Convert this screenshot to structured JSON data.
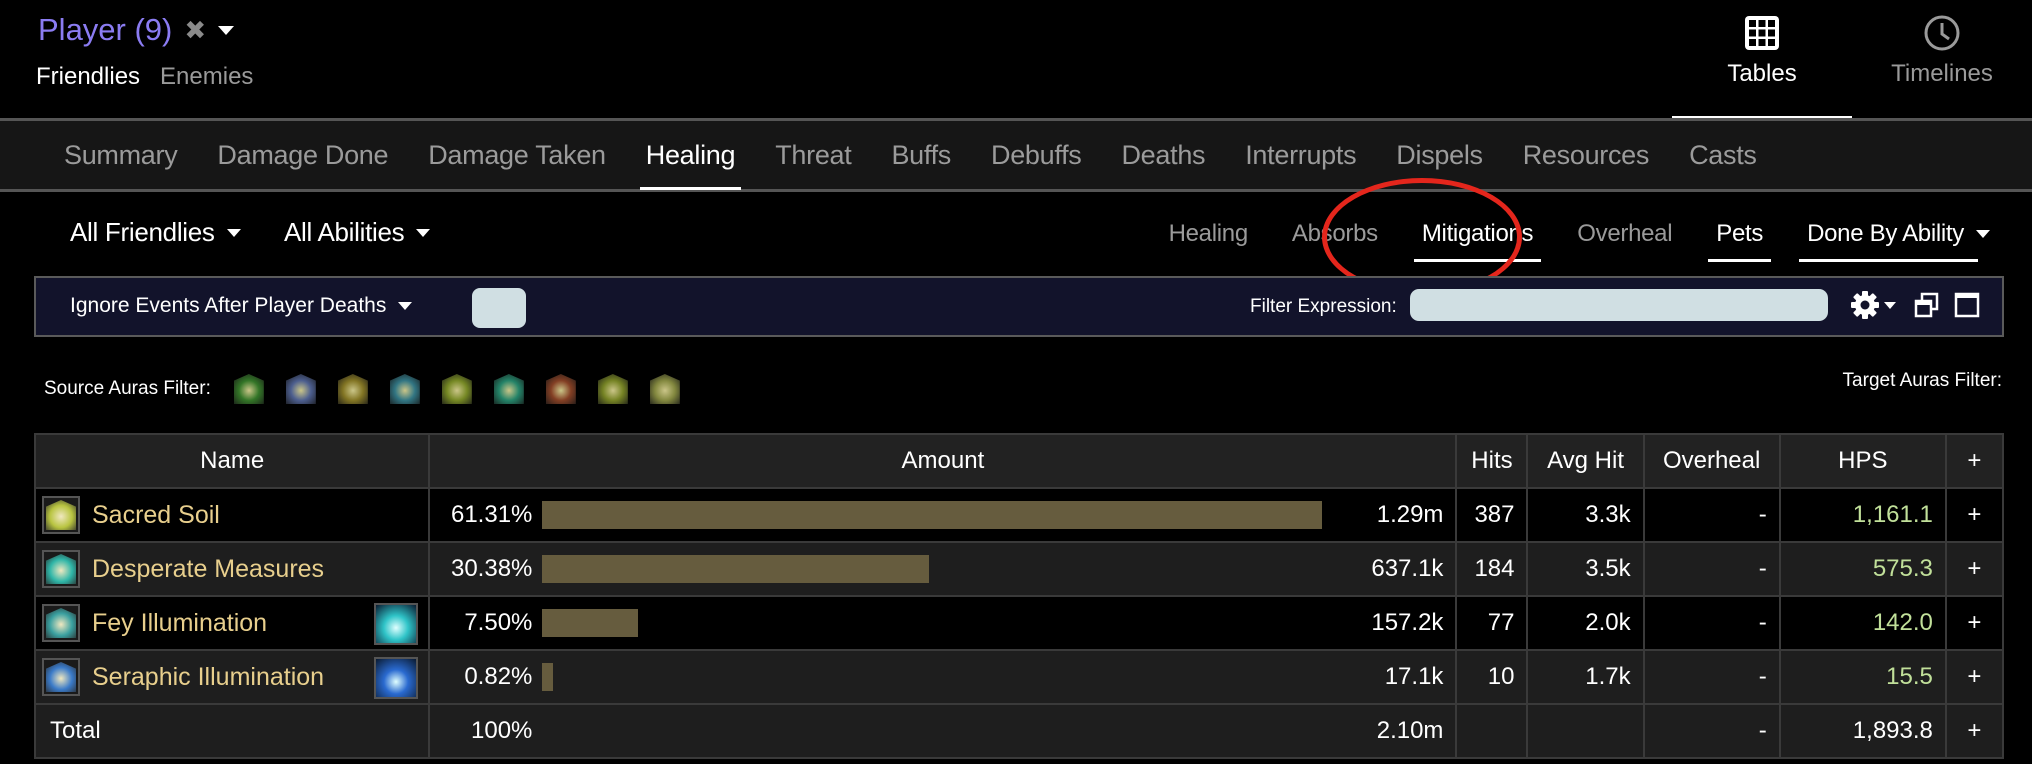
{
  "header": {
    "player_label": "Player (9)",
    "clear_icon": "close-icon",
    "scope": {
      "active": "Friendlies",
      "inactive": "Enemies"
    }
  },
  "view_tabs": [
    {
      "label": "Tables",
      "icon": "grid-icon",
      "active": true
    },
    {
      "label": "Timelines",
      "icon": "clock-icon",
      "active": false
    }
  ],
  "tabs": [
    {
      "label": "Summary",
      "active": false
    },
    {
      "label": "Damage Done",
      "active": false
    },
    {
      "label": "Damage Taken",
      "active": false
    },
    {
      "label": "Healing",
      "active": true
    },
    {
      "label": "Threat",
      "active": false
    },
    {
      "label": "Buffs",
      "active": false
    },
    {
      "label": "Debuffs",
      "active": false
    },
    {
      "label": "Deaths",
      "active": false
    },
    {
      "label": "Interrupts",
      "active": false
    },
    {
      "label": "Dispels",
      "active": false
    },
    {
      "label": "Resources",
      "active": false
    },
    {
      "label": "Casts",
      "active": false
    }
  ],
  "filters": {
    "source_dropdown": "All Friendlies",
    "ability_dropdown": "All Abilities",
    "modes": [
      {
        "label": "Healing",
        "active": false
      },
      {
        "label": "Absorbs",
        "active": false
      },
      {
        "label": "Mitigations",
        "active": true
      },
      {
        "label": "Overheal",
        "active": false
      },
      {
        "label": "Pets",
        "active": true
      }
    ],
    "grouping_dropdown": "Done By Ability",
    "highlight_color": "#e4261c"
  },
  "filter_bar": {
    "ignore_label": "Ignore Events After Player Deaths",
    "expression_label": "Filter Expression:",
    "expression_value": "",
    "gear_icon": "gear-icon",
    "popout_icon": "popout-icon",
    "maximize_icon": "maximize-icon"
  },
  "auras": {
    "source_label": "Source Auras Filter:",
    "target_label": "Target Auras Filter:",
    "source_icons": [
      {
        "name": "aura-icon-1",
        "color": "#3c8a2e"
      },
      {
        "name": "aura-icon-2",
        "color": "#5a6fa8"
      },
      {
        "name": "aura-icon-3",
        "color": "#9a8a2a"
      },
      {
        "name": "aura-icon-4",
        "color": "#3a8a9a"
      },
      {
        "name": "aura-icon-5",
        "color": "#8aa02a"
      },
      {
        "name": "aura-icon-6",
        "color": "#2a9a7a"
      },
      {
        "name": "aura-icon-7",
        "color": "#9a4a2a"
      },
      {
        "name": "aura-icon-8",
        "color": "#8a9a2a"
      },
      {
        "name": "aura-icon-9",
        "color": "#9aa04a"
      }
    ]
  },
  "table": {
    "columns": [
      "Name",
      "Amount",
      "Hits",
      "Avg Hit",
      "Overheal",
      "HPS",
      "+"
    ],
    "bar_color": "#665c3e",
    "rows": [
      {
        "name": "Sacred Soil",
        "icon_color": "#b8c440",
        "pet_icon": null,
        "pct": "61.31%",
        "pct_value": 61.31,
        "amount": "1.29m",
        "hits": "387",
        "avg_hit": "3.3k",
        "overheal": "-",
        "hps": "1,161.1"
      },
      {
        "name": "Desperate Measures",
        "icon_color": "#2fb6a8",
        "pet_icon": null,
        "pct": "30.38%",
        "pct_value": 30.38,
        "amount": "637.1k",
        "hits": "184",
        "avg_hit": "3.5k",
        "overheal": "-",
        "hps": "575.3"
      },
      {
        "name": "Fey Illumination",
        "icon_color": "#3aa0a0",
        "pet_icon": "#2fc4c8",
        "pct": "7.50%",
        "pct_value": 7.5,
        "amount": "157.2k",
        "hits": "77",
        "avg_hit": "2.0k",
        "overheal": "-",
        "hps": "142.0"
      },
      {
        "name": "Seraphic Illumination",
        "icon_color": "#3a7ac8",
        "pet_icon": "#2a6ad0",
        "pct": "0.82%",
        "pct_value": 0.82,
        "amount": "17.1k",
        "hits": "10",
        "avg_hit": "1.7k",
        "overheal": "-",
        "hps": "15.5"
      }
    ],
    "total": {
      "name": "Total",
      "pct": "100%",
      "amount": "2.10m",
      "hits": "",
      "avg_hit": "",
      "overheal": "-",
      "hps": "1,893.8"
    },
    "expand_label": "+"
  }
}
